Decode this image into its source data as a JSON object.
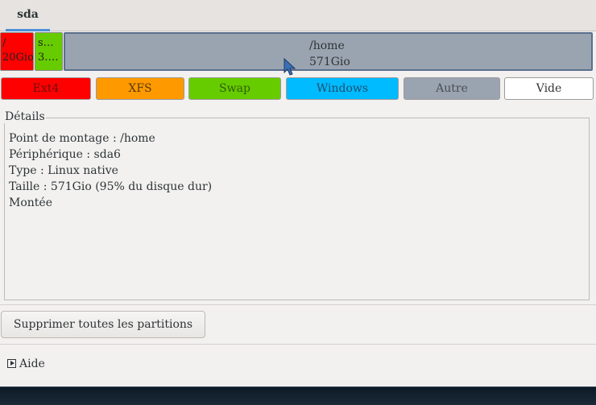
{
  "tabs": [
    {
      "label": "sda"
    }
  ],
  "partitions": {
    "root": {
      "line1": "/",
      "line2": "20Gio"
    },
    "swap": {
      "line1": "s…",
      "line2": "3…."
    },
    "home": {
      "line1": "/home",
      "line2": "571Gio"
    }
  },
  "legend": {
    "ext4": "Ext4",
    "xfs": "XFS",
    "swap": "Swap",
    "windows": "Windows",
    "autre": "Autre",
    "vide": "Vide"
  },
  "details": {
    "title": "Détails",
    "lines": [
      "Point de montage : /home",
      "Périphérique : sda6",
      "Type : Linux native",
      "Taille : 571Gio (95% du disque dur)",
      "Montée"
    ]
  },
  "buttons": {
    "delete_all": "Supprimer toutes les partitions"
  },
  "help": {
    "label": "Aide"
  },
  "colors": {
    "ext4": "#ff0000",
    "xfs": "#ff9900",
    "swap": "#66cc00",
    "windows": "#00bbff",
    "autre": "#9aa4b0",
    "vide": "#ffffff",
    "tab_accent": "#4a90d9"
  }
}
